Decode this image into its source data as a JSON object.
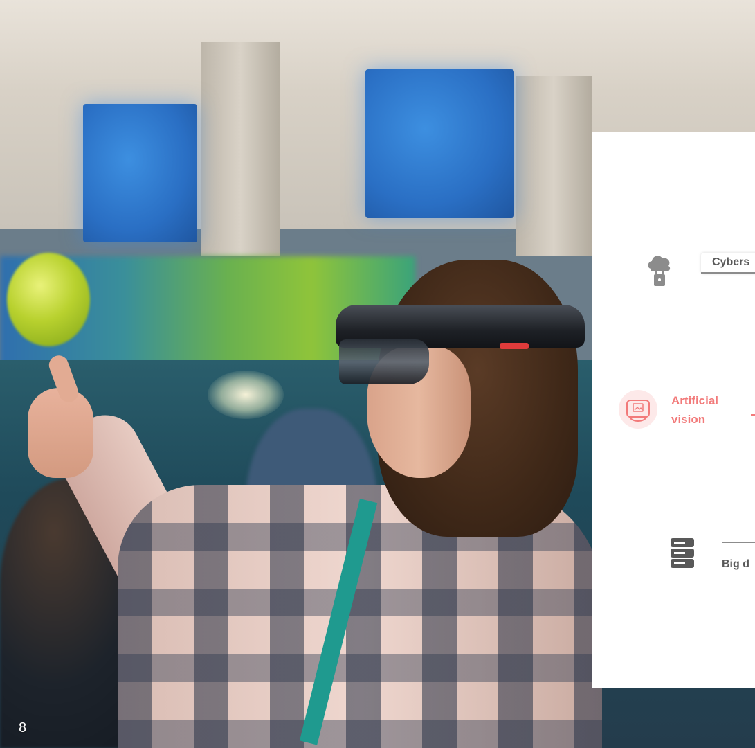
{
  "slide": {
    "page_number": "8"
  },
  "panel": {
    "items": [
      {
        "label": "Cybers",
        "icon": "cloud-lock-icon",
        "color": "#595959"
      },
      {
        "label": "Artificial vision",
        "label_line1": "Artificial",
        "label_line2": "vision",
        "icon": "vr-headset-icon",
        "color": "#f27a7a"
      },
      {
        "label": "Big d",
        "icon": "server-icon",
        "color": "#595959"
      }
    ]
  },
  "colors": {
    "accent_pink": "#f27a7a",
    "text_gray": "#595959",
    "icon_gray": "#8c8c8c",
    "panel_bg": "#ffffff"
  }
}
